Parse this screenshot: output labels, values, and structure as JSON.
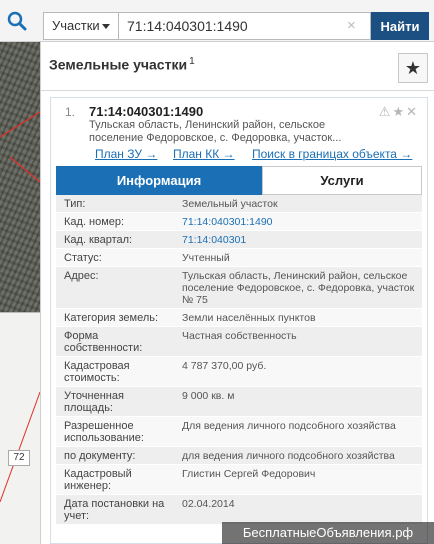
{
  "topbar": {
    "search_icon": "search-icon",
    "type_select_value": "Участки",
    "search_value": "71:14:040301:1490",
    "clear_glyph": "×",
    "find_label": "Найти"
  },
  "map": {
    "label": "72"
  },
  "panel": {
    "title": "Земельные участки",
    "title_sup": "1",
    "fav_glyph": "★"
  },
  "result": {
    "number": "1.",
    "title": "71:14:040301:1490",
    "icons": "⚠★✕",
    "address": "Тульская область, Ленинский район, сельское поселение Федоровское, с. Федоровка, участок...",
    "links": {
      "plan_zu": "План ЗУ →",
      "plan_kk": "План КК →",
      "search": "Поиск в границах объекта →"
    },
    "tabs": {
      "info": "Информация",
      "services": "Услуги"
    },
    "props": [
      {
        "label": "Тип:",
        "value": "Земельный участок"
      },
      {
        "label": "Кад. номер:",
        "value": "71:14:040301:1490"
      },
      {
        "label": "Кад. квартал:",
        "value": "71:14:040301"
      },
      {
        "label": "Статус:",
        "value": "Учтенный"
      },
      {
        "label": "Адрес:",
        "value": "Тульская область, Ленинский район, сельское поселение Федоровское, с. Федоровка, участок № 75"
      },
      {
        "label": "Категория земель:",
        "value": "Земли населённых пунктов"
      },
      {
        "label": "Форма собственности:",
        "value": "Частная собственность"
      },
      {
        "label": "Кадастровая стоимость:",
        "value": "4 787 370,00 руб."
      },
      {
        "label": "Уточненная площадь:",
        "value": "9 000 кв. м"
      },
      {
        "label": "Разрешенное использование:",
        "value": "Для ведения личного подсобного хозяйства"
      },
      {
        "label": "по документу:",
        "value": "для ведения личного подсобного хозяйства"
      },
      {
        "label": "Кадастровый инженер:",
        "value": "Глистин Сергей Федорович"
      },
      {
        "label": "Дата постановки на учет:",
        "value": "02.04.2014"
      }
    ]
  },
  "watermark": "БесплатныеОбъявления.рф",
  "colors": {
    "accent": "#1a6fb5",
    "find_button": "#1c4f82"
  }
}
